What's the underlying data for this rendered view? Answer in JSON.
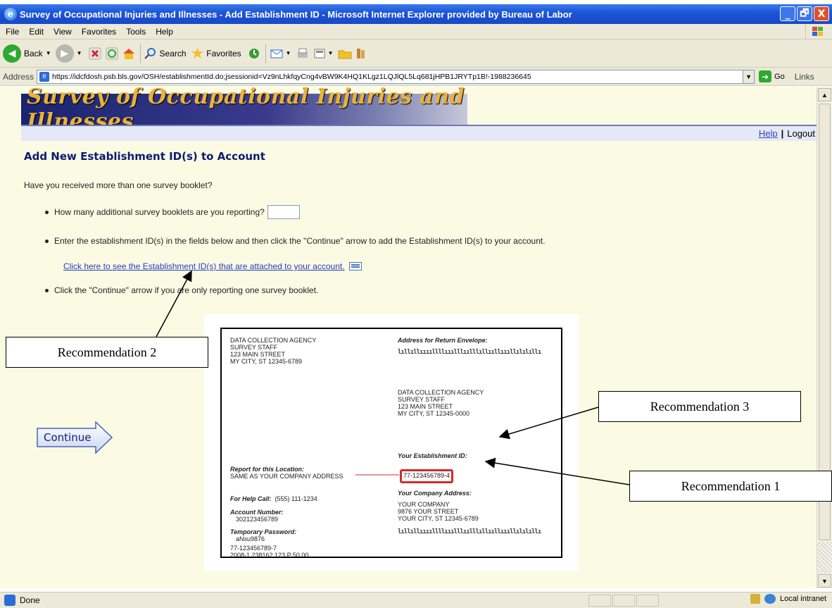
{
  "window": {
    "title": "Survey of Occupational Injuries and Illnesses - Add Establishment ID - Microsoft Internet Explorer provided by Bureau of Labor",
    "controls": [
      "_",
      "🗗",
      "X"
    ]
  },
  "menu": [
    "File",
    "Edit",
    "View",
    "Favorites",
    "Tools",
    "Help"
  ],
  "toolbar": {
    "back": "Back",
    "search": "Search",
    "favorites": "Favorites"
  },
  "address": {
    "label": "Address",
    "url": "https://idcfdosh.psb.bls.gov/OSH/establishmentId.do;jsessionid=Vz9nLhkfqyCng4vBW9K4HQ1KLgz1LQJlQL5Lq681jHPB1JRYTp1B!-1988236645",
    "go": "Go",
    "links": "Links"
  },
  "banner": "Survey of Occupational Injuries and Illnesses",
  "nav": {
    "help": "Help",
    "separator": "|",
    "logout": "Logout"
  },
  "page": {
    "title": "Add New Establishment ID(s) to Account",
    "intro": "Have you received more than one survey booklet?",
    "bullet1": "How many additional survey booklets are you reporting?",
    "booklet_count_value": "",
    "bullet2": "Enter the establishment ID(s) in the fields below and then click the \"Continue\" arrow to add the Establishment ID(s) to your account.",
    "attached_link": "Click here to see the Establishment ID(s) that are attached to your account.",
    "bullet3": "Click the \"Continue\" arrow if you are only reporting one survey booklet.",
    "continue": "Continue"
  },
  "booklet": {
    "sender": [
      "DATA COLLECTION AGENCY",
      "SURVEY STAFF",
      "123 MAIN STREET",
      "MY CITY, ST  12345-6789"
    ],
    "return_label": "Address for Return Envelope:",
    "barcode": "lıllıllııııllllııılllıılllıllııllıııllılılıllı",
    "recipient": [
      "DATA COLLECTION AGENCY",
      "SURVEY STAFF",
      "123 MAIN STREET",
      "MY CITY, ST  12345-0000"
    ],
    "estid_label": "Your Establishment ID:",
    "estid_value": "77-123456789-4",
    "report_label": "Report for this Location:",
    "report_value": "SAME AS YOUR COMPANY ADDRESS",
    "company_label": "Your Company Address:",
    "company": [
      "YOUR COMPANY",
      "9876 YOUR STREET",
      "YOUR CITY, ST 12345-6789"
    ],
    "help_label": "For Help Call:",
    "help_value": "(555) 111-1234",
    "account_label": "Account Number:",
    "account_value": "302123456789",
    "password_label": "Temporary Password:",
    "password_value": "aNsu9876",
    "footer1": "77-123456789-7",
    "footer2": "2008-1   238162     123    P    50    00"
  },
  "callouts": {
    "rec1": "Recommendation 1",
    "rec2": "Recommendation 2",
    "rec3": "Recommendation 3"
  },
  "status": {
    "text": "Done",
    "zone": "Local intranet"
  },
  "colors": {
    "title_blue": "#0d1a73",
    "link_blue": "#2a3bbf",
    "page_bg": "#fbfbe3",
    "highlight_red": "#d42a2a"
  }
}
